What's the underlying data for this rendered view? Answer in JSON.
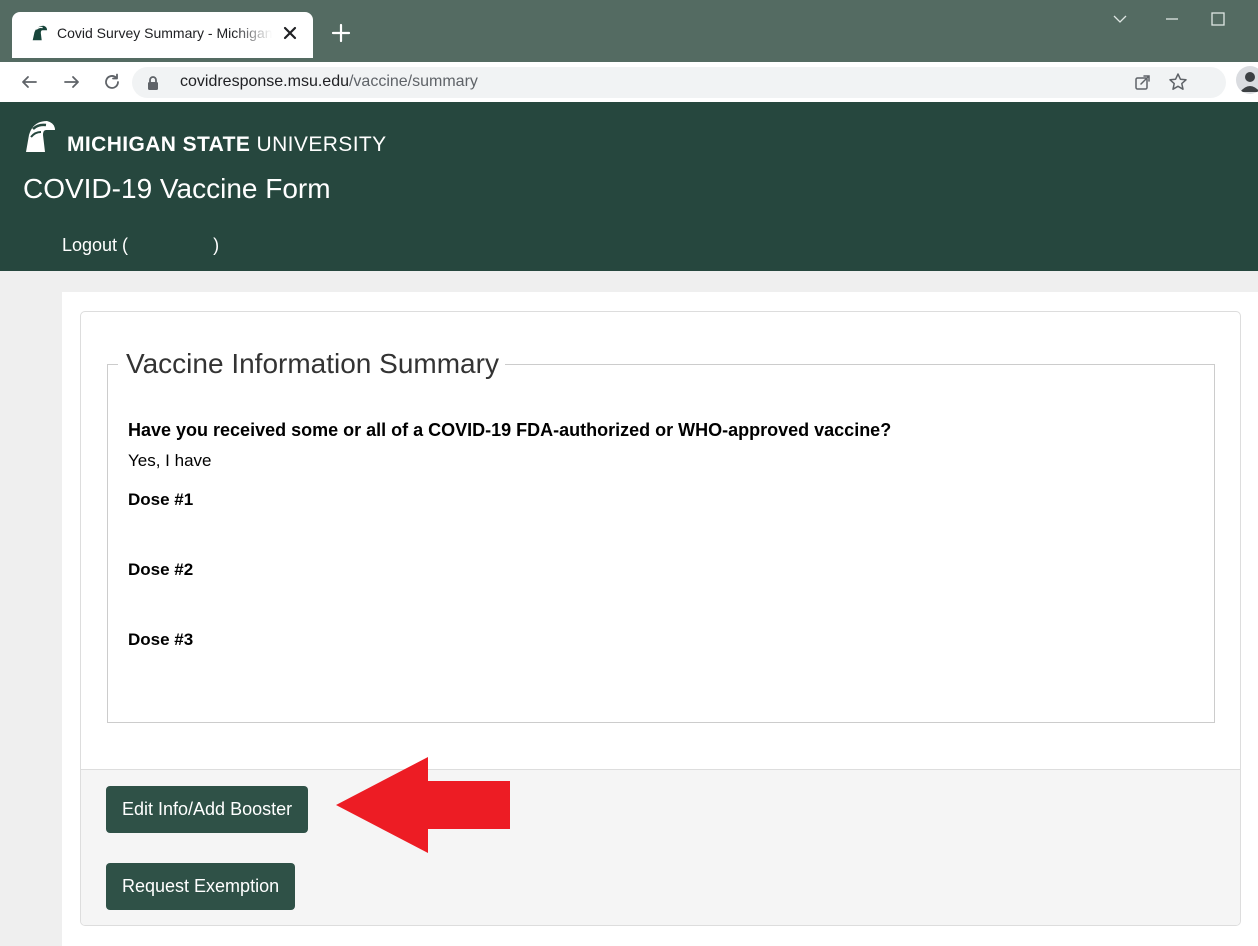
{
  "browser": {
    "tab_title": "Covid Survey Summary - Michigan State University",
    "url_domain": "covidresponse.msu.edu",
    "url_path": "/vaccine/summary",
    "icons": [
      "spartan-favicon",
      "close-icon",
      "plus-icon",
      "back-arrow-icon",
      "forward-arrow-icon",
      "reload-icon",
      "lock-icon",
      "share-icon",
      "star-icon",
      "profile-icon",
      "chevron-down-icon",
      "minimize-icon",
      "maximize-icon"
    ]
  },
  "header": {
    "brand_bold": "MICHIGAN STATE",
    "brand_light": " UNIVERSITY",
    "form_title": "COVID-19 Vaccine Form",
    "logout_label": "Logout (                 )"
  },
  "summary": {
    "legend": "Vaccine Information Summary",
    "question": "Have you received some or all of a COVID-19 FDA-authorized or WHO-approved vaccine?",
    "answer": "Yes, I have",
    "doses": [
      "Dose #1",
      "Dose #2",
      "Dose #3"
    ]
  },
  "footer": {
    "edit_button": "Edit Info/Add Booster",
    "exemption_button": "Request Exemption"
  },
  "colors": {
    "msu_green": "#26473e",
    "button_green": "#2f5147",
    "annotation_red": "#ed1c24",
    "tabbar": "#546b62"
  }
}
